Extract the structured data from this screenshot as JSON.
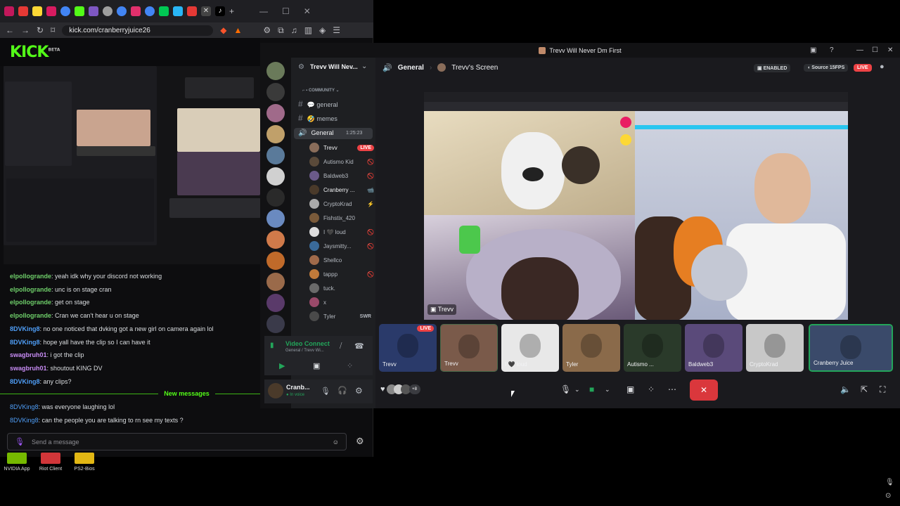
{
  "browser": {
    "url": "kick.com/cranberryjuice26",
    "logo": "KICK",
    "logo_tag": "BETA"
  },
  "chat": {
    "messages": [
      {
        "user": "elpollogrande",
        "text": ": yeah idk why your discord not working",
        "color": "#6fcf6a"
      },
      {
        "user": "elpollogrande",
        "text": ": unc is on stage cran",
        "color": "#6fcf6a"
      },
      {
        "user": "elpollogrande",
        "text": ": get on stage",
        "color": "#6fcf6a"
      },
      {
        "user": "elpollogrande",
        "text": ": Cran we can't hear u on stage",
        "color": "#6fcf6a"
      },
      {
        "user": "8DVKing8",
        "text": ": no one noticed that dvking got a new girl on camera again lol",
        "color": "#4f9ef7"
      },
      {
        "user": "8DVKing8",
        "text": ": hope yall have the clip so I can have it",
        "color": "#4f9ef7"
      },
      {
        "user": "swagbruh01",
        "text": ": i got the clip",
        "color": "#c88cf5"
      },
      {
        "user": "swagbruh01",
        "text": ": shoutout KING DV",
        "color": "#c88cf5"
      },
      {
        "user": "8DVKing8",
        "text": ": any clips?",
        "color": "#4f9ef7"
      }
    ],
    "new_messages_label": "New messages",
    "after_messages": [
      {
        "user": "8DVKing8",
        "text": ": was everyone laughing lol",
        "color": "#4f9ef7"
      },
      {
        "user": "8DVKing8",
        "text": ": can the people you are talking to rn see my texts ?",
        "color": "#4f9ef7"
      }
    ],
    "input_placeholder": "Send a message"
  },
  "desktop": {
    "icons": [
      {
        "label": "NVIDIA App",
        "color": "#76b900"
      },
      {
        "label": "Riot Client",
        "color": "#d13639"
      },
      {
        "label": "PS2-Bios",
        "color": "#e2b714"
      }
    ]
  },
  "discord": {
    "window_title": "Trevv Will Never Dm First",
    "server_name": "Trevv Will Nev...",
    "category": "COMMUNITY",
    "channels": [
      {
        "name": "general",
        "emoji": "💬"
      },
      {
        "name": "memes",
        "emoji": "🤣"
      }
    ],
    "voice_channel": {
      "name": "General",
      "timer": "1:25:23"
    },
    "members": [
      {
        "name": "Trevv",
        "badge": "LIVE",
        "icon": "",
        "color": "#8a6d5a"
      },
      {
        "name": "Autismo Kid",
        "badge": "",
        "icon": "🚫",
        "color": "#5a4a3a"
      },
      {
        "name": "Baldweb3",
        "badge": "",
        "icon": "🚫",
        "color": "#6b5a8a"
      },
      {
        "name": "Cranberry ...",
        "badge": "",
        "icon": "📹",
        "color": "#4a3a2a"
      },
      {
        "name": "CryptoKrad",
        "badge": "",
        "icon": "⚡",
        "color": "#aaaaaa"
      },
      {
        "name": "Fishstix_420",
        "badge": "",
        "icon": "",
        "color": "#7a5a3a"
      },
      {
        "name": "I 🖤 loud",
        "badge": "",
        "icon": "🚫",
        "color": "#dddddd"
      },
      {
        "name": "Jaysmitty...",
        "badge": "",
        "icon": "🚫",
        "color": "#3a6a9a"
      },
      {
        "name": "Shellco",
        "badge": "",
        "icon": "",
        "color": "#a06a4a"
      },
      {
        "name": "tappp",
        "badge": "",
        "icon": "🚫",
        "color": "#c07a3a"
      },
      {
        "name": "tuck.",
        "badge": "",
        "icon": "",
        "color": "#6a6a6a"
      },
      {
        "name": "x",
        "badge": "",
        "icon": "",
        "color": "#9a4a6a"
      },
      {
        "name": "Tyler",
        "badge": "SWR",
        "icon": "",
        "color": "#4a4a4a"
      }
    ],
    "voice_status": {
      "title": "Video Connect",
      "sub": "General / Trevv Wi..."
    },
    "user": {
      "name": "Cranb...",
      "status": "In voice"
    },
    "stage": {
      "channel": "General",
      "screen_owner": "Trevv's Screen",
      "enabled_label": "ENABLED",
      "source_label": "Source 15FPS",
      "live_label": "LIVE",
      "share_overlay_label": "Trevv",
      "reaction_count": "+8"
    },
    "tiles": [
      {
        "name": "Trevv",
        "color": "#2a3a6a",
        "live": "LIVE"
      },
      {
        "name": "Trevv",
        "color": "#7a5a4a",
        "live": ""
      },
      {
        "name": "I 🖤 loud",
        "color": "#e8e8e8",
        "live": ""
      },
      {
        "name": "Tyler",
        "color": "#8a6a4a",
        "live": ""
      },
      {
        "name": "Autismo ...",
        "color": "#2a3a2a",
        "live": ""
      },
      {
        "name": "Baldweb3",
        "color": "#5a4a7a",
        "live": ""
      },
      {
        "name": "CryptoKrad",
        "color": "#c8c8c8",
        "live": ""
      },
      {
        "name": "Cranberry Juice",
        "color": "#3a4a6a",
        "live": ""
      }
    ],
    "accent": "#5865f2",
    "end_call_color": "#da373c"
  }
}
